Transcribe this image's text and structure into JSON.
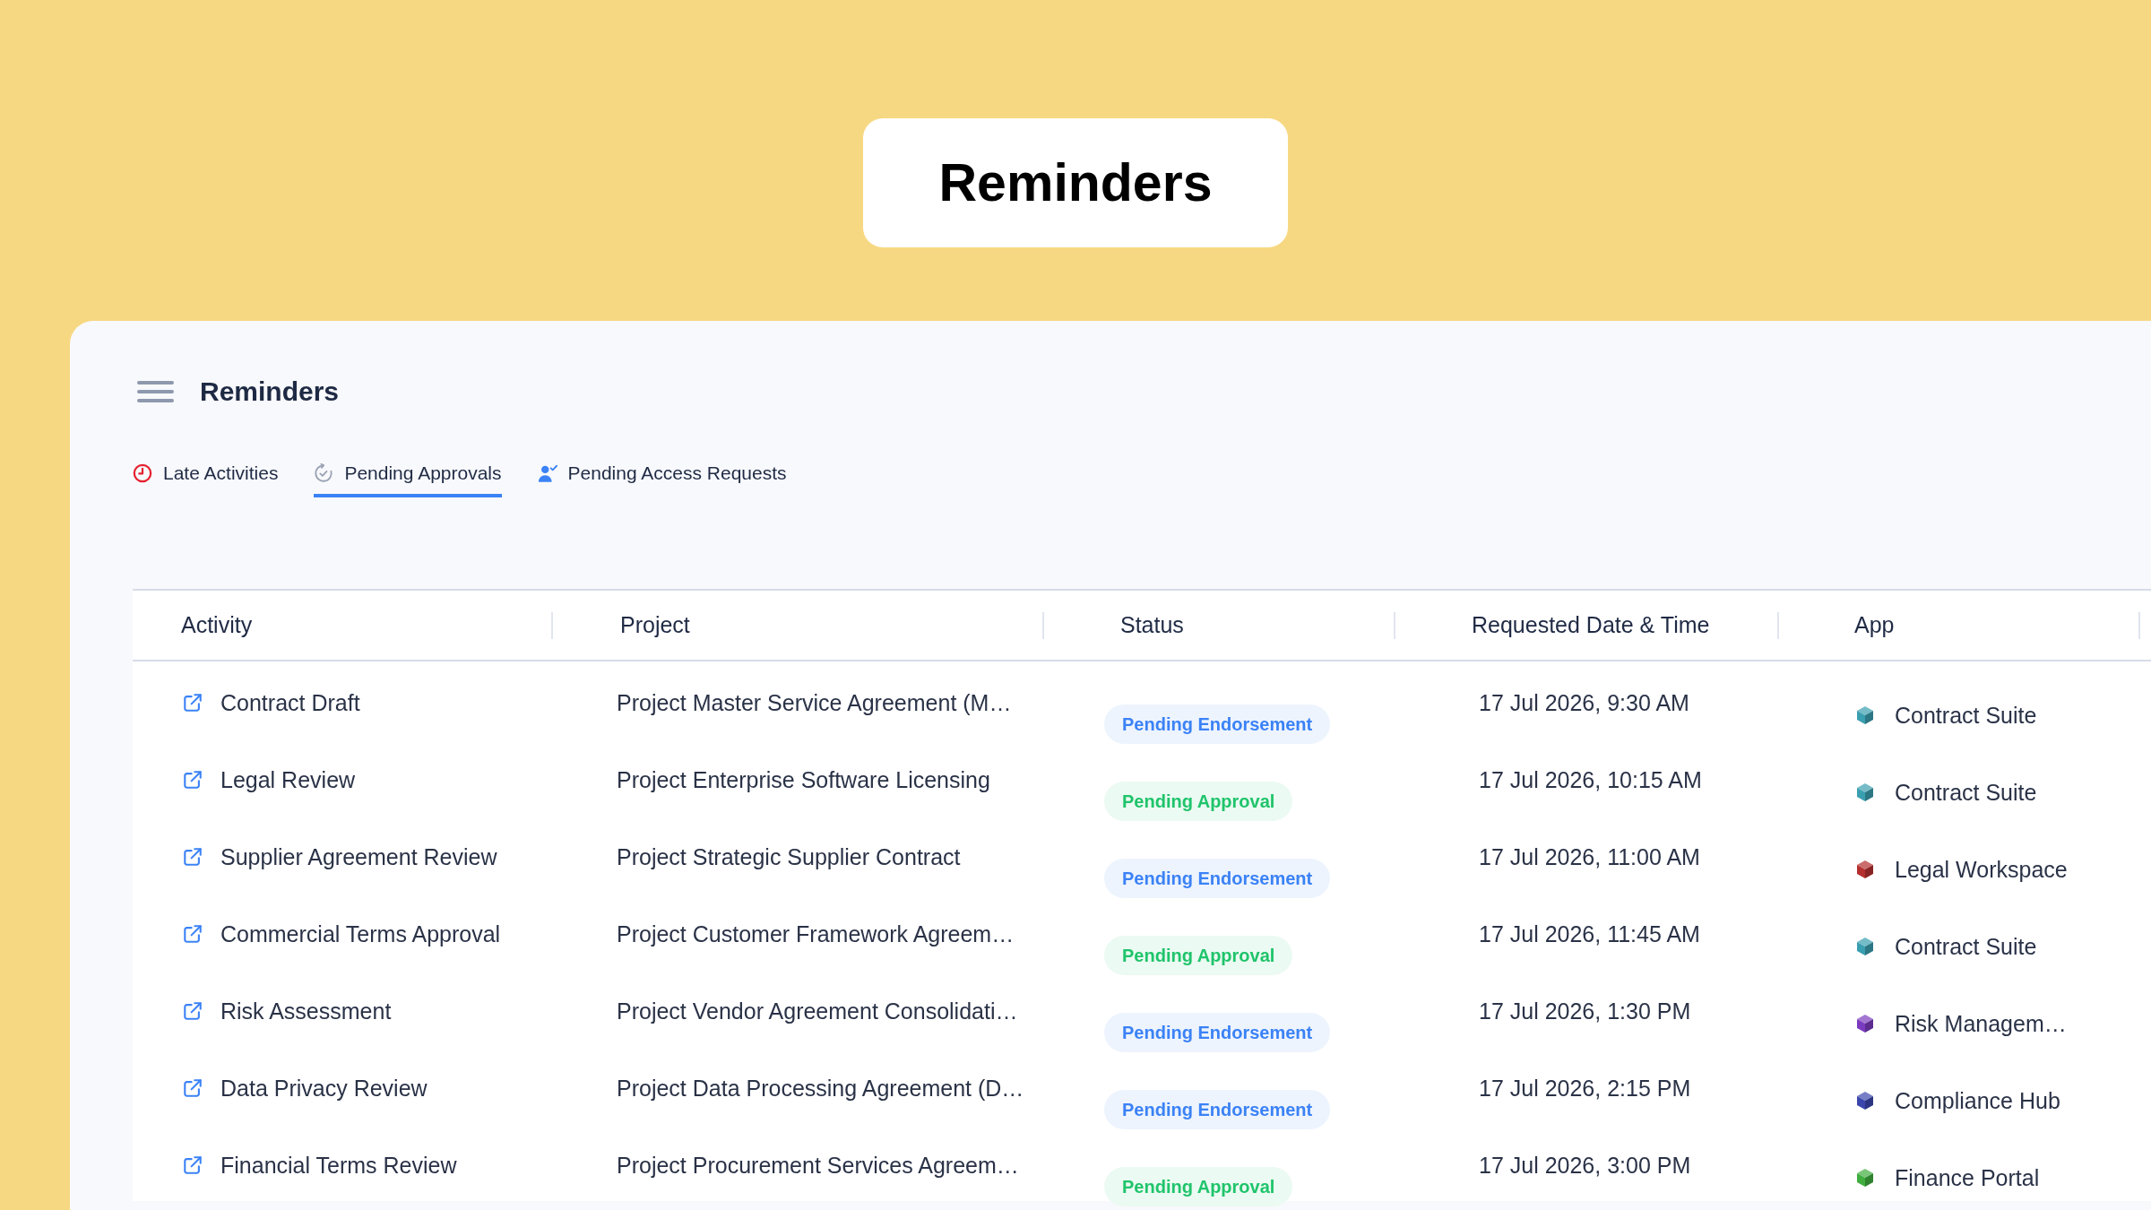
{
  "banner": {
    "title": "Reminders"
  },
  "panel": {
    "title": "Reminders",
    "tabs": [
      {
        "label": "Late Activities",
        "selected": false
      },
      {
        "label": "Pending Approvals",
        "selected": true
      },
      {
        "label": "Pending Access Requests",
        "selected": false
      }
    ],
    "table": {
      "columns": [
        "Activity",
        "Project",
        "Status",
        "Requested Date & Time",
        "App"
      ],
      "rows": [
        {
          "activity": "Contract Draft",
          "project": "Project Master Service Agreement (M…",
          "status": {
            "label": "Pending Endorsement",
            "color": "#3b82f6"
          },
          "requested": "17 Jul 2026, 9:30 AM",
          "app": {
            "name": "Contract Suite",
            "color": "#3a9fb0"
          }
        },
        {
          "activity": "Legal Review",
          "project": "Project Enterprise Software Licensing",
          "status": {
            "label": "Pending Approval",
            "color": "#1fc46b"
          },
          "requested": "17 Jul 2026, 10:15 AM",
          "app": {
            "name": "Contract Suite",
            "color": "#3a9fb0"
          }
        },
        {
          "activity": "Supplier Agreement Review",
          "project": "Project Strategic Supplier Contract",
          "status": {
            "label": "Pending Endorsement",
            "color": "#3b82f6"
          },
          "requested": "17 Jul 2026, 11:00 AM",
          "app": {
            "name": "Legal Workspace",
            "color": "#b52f2f"
          }
        },
        {
          "activity": "Commercial Terms Approval",
          "project": "Project Customer Framework Agreem…",
          "status": {
            "label": "Pending Approval",
            "color": "#1fc46b"
          },
          "requested": "17 Jul 2026, 11:45 AM",
          "app": {
            "name": "Contract Suite",
            "color": "#3a9fb0"
          }
        },
        {
          "activity": "Risk Assessment",
          "project": "Project Vendor Agreement Consolidati…",
          "status": {
            "label": "Pending Endorsement",
            "color": "#3b82f6"
          },
          "requested": "17 Jul 2026, 1:30 PM",
          "app": {
            "name": "Risk Managem…",
            "color": "#7b3bbf"
          }
        },
        {
          "activity": "Data Privacy Review",
          "project": "Project Data Processing Agreement (D…",
          "status": {
            "label": "Pending Endorsement",
            "color": "#3b82f6"
          },
          "requested": "17 Jul 2026, 2:15 PM",
          "app": {
            "name": "Compliance Hub",
            "color": "#3b46ad"
          }
        },
        {
          "activity": "Financial Terms Review",
          "project": "Project Procurement Services Agreem…",
          "status": {
            "label": "Pending Approval",
            "color": "#1fc46b"
          },
          "requested": "17 Jul 2026, 3:00 PM",
          "app": {
            "name": "Finance Portal",
            "color": "#3fae3f"
          }
        }
      ]
    }
  }
}
